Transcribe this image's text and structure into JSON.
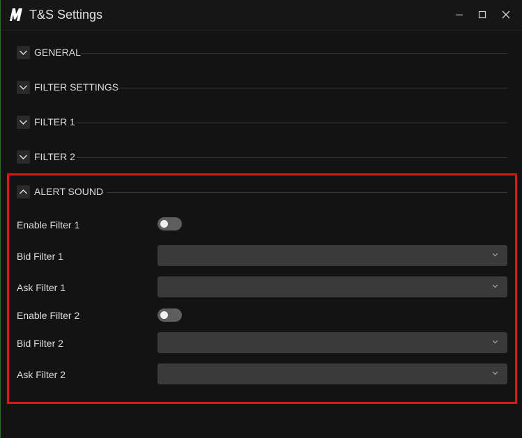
{
  "window": {
    "title": "T&S Settings",
    "logo_icon": "m-logo-icon",
    "controls": [
      "minimize-icon",
      "maximize-icon",
      "close-icon"
    ],
    "border_color": "#2a6f2a"
  },
  "sections": {
    "general": {
      "label": "GENERAL",
      "expanded": false
    },
    "filter_settings": {
      "label": "FILTER SETTINGS",
      "expanded": false
    },
    "filter1": {
      "label": "FILTER 1",
      "expanded": false
    },
    "filter2": {
      "label": "FILTER 2",
      "expanded": false
    },
    "alert_sound": {
      "label": "ALERT SOUND",
      "expanded": true
    }
  },
  "alert_sound": {
    "highlight_color": "#d9191c",
    "enable_filter_1": {
      "label": "Enable Filter 1",
      "on": false
    },
    "bid_filter_1": {
      "label": "Bid Filter 1",
      "value": ""
    },
    "ask_filter_1": {
      "label": "Ask Filter 1",
      "value": ""
    },
    "enable_filter_2": {
      "label": "Enable Filter 2",
      "on": false
    },
    "bid_filter_2": {
      "label": "Bid Filter 2",
      "value": ""
    },
    "ask_filter_2": {
      "label": "Ask Filter 2",
      "value": ""
    }
  }
}
